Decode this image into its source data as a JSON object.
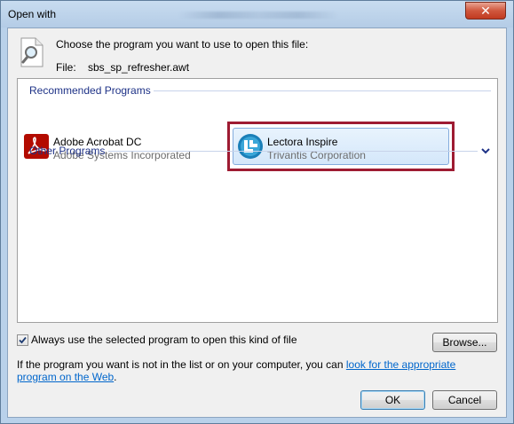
{
  "window": {
    "title": "Open with",
    "close_glyph": "✕"
  },
  "header": {
    "prompt": "Choose the program you want to use to open this file:",
    "file_label": "File:",
    "file_name": "sbs_sp_refresher.awt",
    "icon": "file-search-icon"
  },
  "groups": {
    "recommended": "Recommended Programs",
    "other": "Other Programs"
  },
  "programs": [
    {
      "name": "Adobe Acrobat DC",
      "publisher": "Adobe Systems Incorporated",
      "icon": "acrobat-icon",
      "selected": false
    },
    {
      "name": "Lectora Inspire",
      "publisher": "Trivantis Corporation",
      "icon": "lectora-icon",
      "selected": true
    }
  ],
  "options": {
    "always_use_label": "Always use the selected program to open this kind of file",
    "always_use_checked": true,
    "browse_label": "Browse..."
  },
  "info": {
    "prefix": "If the program you want is not in the list or on your computer, you can ",
    "link": "look for the appropriate program on the Web",
    "suffix": "."
  },
  "buttons": {
    "ok": "OK",
    "cancel": "Cancel"
  },
  "colors": {
    "group_header": "#1e3287",
    "selection_outline": "#9e1b32",
    "link": "#0066cc"
  }
}
